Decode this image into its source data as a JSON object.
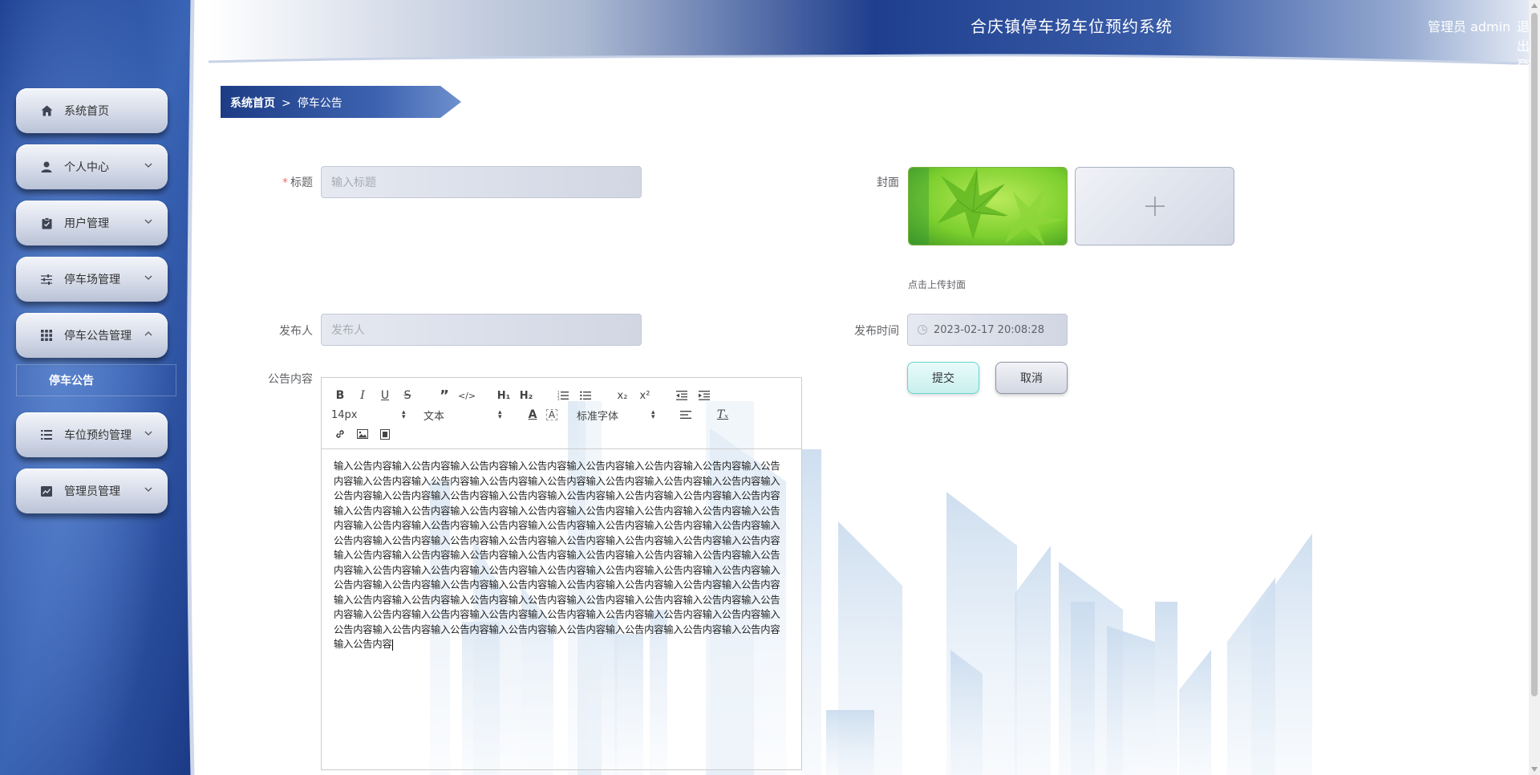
{
  "header": {
    "site_title": "合庆镇停车场车位预约系统",
    "user_info": "管理员 admin",
    "logout_label": "退出登录"
  },
  "sidebar": {
    "items": [
      {
        "label": "系统首页",
        "icon": "home-icon",
        "has_arrow": false
      },
      {
        "label": "个人中心",
        "icon": "user-icon",
        "has_arrow": true
      },
      {
        "label": "用户管理",
        "icon": "clipboard-icon",
        "has_arrow": true
      },
      {
        "label": "停车场管理",
        "icon": "sliders-icon",
        "has_arrow": true
      },
      {
        "label": "停车公告管理",
        "icon": "grid-icon",
        "has_arrow": true,
        "expanded": true
      },
      {
        "label": "车位预约管理",
        "icon": "list-icon",
        "has_arrow": true
      },
      {
        "label": "管理员管理",
        "icon": "chart-icon",
        "has_arrow": true
      }
    ],
    "submenu": {
      "label": "停车公告"
    }
  },
  "breadcrumb": {
    "home": "系统首页",
    "separator": ">",
    "current": "停车公告"
  },
  "form": {
    "title_label": "标题",
    "title_placeholder": "输入标题",
    "publisher_label": "发布人",
    "publisher_placeholder": "发布人",
    "content_label": "公告内容",
    "cover_label": "封面",
    "cover_hint": "点击上传封面",
    "time_label": "发布时间",
    "time_value": "2023-02-17 20:08:28",
    "submit_label": "提交",
    "cancel_label": "取消"
  },
  "editor": {
    "font_size": "14px",
    "text_type": "文本",
    "font_family": "标准字体",
    "content": "输入公告内容输入公告内容输入公告内容输入公告内容输入公告内容输入公告内容输入公告内容输入公告内容输入公告内容输入公告内容输入公告内容输入公告内容输入公告内容输入公告内容输入公告内容输入公告内容输入公告内容输入公告内容输入公告内容输入公告内容输入公告内容输入公告内容输入公告内容输入公告内容输入公告内容输入公告内容输入公告内容输入公告内容输入公告内容输入公告内容输入公告内容输入公告内容输入公告内容输入公告内容输入公告内容输入公告内容输入公告内容输入公告内容输入公告内容输入公告内容输入公告内容输入公告内容输入公告内容输入公告内容输入公告内容输入公告内容输入公告内容输入公告内容输入公告内容输入公告内容输入公告内容输入公告内容输入公告内容输入公告内容输入公告内容输入公告内容输入公告内容输入公告内容输入公告内容输入公告内容输入公告内容输入公告内容输入公告内容输入公告内容输入公告内容输入公告内容输入公告内容输入公告内容输入公告内容输入公告内容输入公告内容输入公告内容输入公告内容输入公告内容输入公告内容输入公告内容输入公告内容输入公告内容输入公告内容输入公告内容输入公告内容输入公告内容输入公告内容输入公告内容输入公告内容输入公告内容输入公告内容输入公告内容输入公告内容输入公告内容输入公告内容输入公告内容输入公告内容"
  },
  "colors": {
    "sidebar_blue": "#1b3f95",
    "header_blue": "#2a4f9e",
    "required": "#f56c6c"
  }
}
